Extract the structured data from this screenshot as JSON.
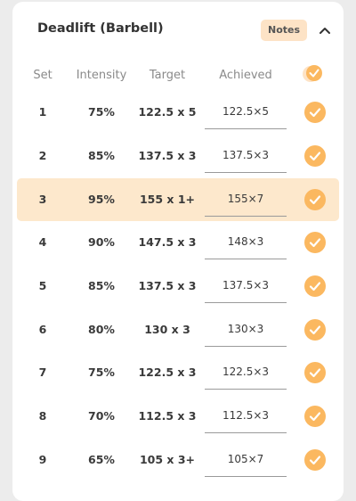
{
  "exercise": {
    "title": "Deadlift (Barbell)",
    "notes_label": "Notes"
  },
  "columns": {
    "set": "Set",
    "intensity": "Intensity",
    "target": "Target",
    "achieved": "Achieved"
  },
  "colors": {
    "accent": "#fbb860",
    "current_row_bg": "#fde8cc",
    "notes_bg": "#fde3c6"
  },
  "icons": {
    "collapse": "chevron-up-icon",
    "check": "checkmark-icon",
    "check_all": "check-all-icon"
  },
  "sets": [
    {
      "set": "1",
      "intensity": "75%",
      "target": "122.5 x 5",
      "achieved": "122.5×5",
      "done": true,
      "current": false
    },
    {
      "set": "2",
      "intensity": "85%",
      "target": "137.5 x 3",
      "achieved": "137.5×3",
      "done": true,
      "current": false
    },
    {
      "set": "3",
      "intensity": "95%",
      "target": "155 x 1+",
      "achieved": "155×7",
      "done": true,
      "current": true
    },
    {
      "set": "4",
      "intensity": "90%",
      "target": "147.5 x 3",
      "achieved": "148×3",
      "done": true,
      "current": false
    },
    {
      "set": "5",
      "intensity": "85%",
      "target": "137.5 x 3",
      "achieved": "137.5×3",
      "done": true,
      "current": false
    },
    {
      "set": "6",
      "intensity": "80%",
      "target": "130 x 3",
      "achieved": "130×3",
      "done": true,
      "current": false
    },
    {
      "set": "7",
      "intensity": "75%",
      "target": "122.5 x 3",
      "achieved": "122.5×3",
      "done": true,
      "current": false
    },
    {
      "set": "8",
      "intensity": "70%",
      "target": "112.5 x 3",
      "achieved": "112.5×3",
      "done": true,
      "current": false
    },
    {
      "set": "9",
      "intensity": "65%",
      "target": "105 x 3+",
      "achieved": "105×7",
      "done": true,
      "current": false
    }
  ]
}
